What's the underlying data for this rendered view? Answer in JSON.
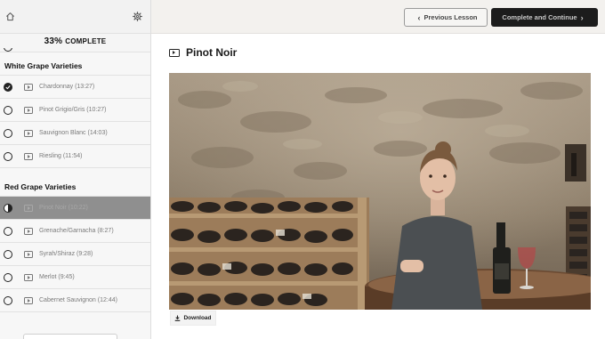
{
  "progress": {
    "percent": "33%",
    "label": "COMPLETE"
  },
  "sections": [
    {
      "title": "White Grape Varieties",
      "lessons": [
        {
          "label": "Chardonnay (13:27)",
          "status": "complete"
        },
        {
          "label": "Pinot Grigio/Gris (10:27)",
          "status": "incomplete"
        },
        {
          "label": "Sauvignon Blanc (14:03)",
          "status": "incomplete"
        },
        {
          "label": "Riesling (11:54)",
          "status": "incomplete"
        }
      ]
    },
    {
      "title": "Red Grape Varieties",
      "lessons": [
        {
          "label": "Pinot Noir (10:22)",
          "status": "in-progress"
        },
        {
          "label": "Grenache/Garnacha (8:27)",
          "status": "incomplete"
        },
        {
          "label": "Syrah/Shiraz (9:28)",
          "status": "incomplete"
        },
        {
          "label": "Merlot (9:45)",
          "status": "incomplete"
        },
        {
          "label": "Cabernet Sauvignon (12:44)",
          "status": "incomplete"
        }
      ]
    }
  ],
  "topbar": {
    "previous_label": "Previous Lesson",
    "next_label": "Complete and Continue"
  },
  "lesson": {
    "title": "Pinot Noir",
    "download_label": "Download"
  },
  "icons": {
    "home": "home-icon",
    "settings": "gear-icon",
    "lesson": "video-icon",
    "download": "download-icon"
  },
  "colors": {
    "active_row": "#8f8f8f",
    "primary_button": "#1c1c1c",
    "topbar": "#f3f1ee"
  }
}
